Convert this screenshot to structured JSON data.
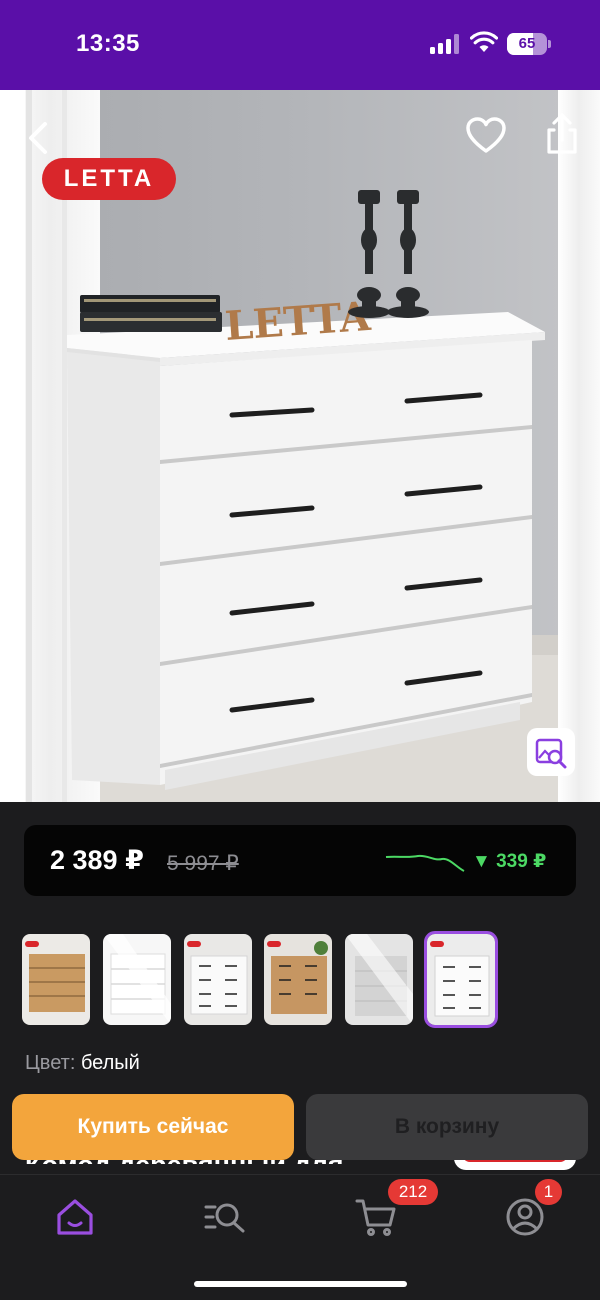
{
  "status_bar": {
    "time": "13:35",
    "battery_level": "65",
    "icons": [
      "signal-icon",
      "wifi-icon",
      "battery-icon"
    ]
  },
  "product_photo": {
    "brand_badge": "LETTA",
    "nav_icons": [
      "back-icon",
      "heart-icon",
      "share-icon",
      "visual-search-icon"
    ]
  },
  "price_card": {
    "current_price": "2 389 ₽",
    "old_price": "5 997 ₽",
    "price_drop": "▼ 339 ₽",
    "drop_color": "#4cd964"
  },
  "color_variants": {
    "thumbnails": [
      "oak",
      "white-glossy",
      "white",
      "oak",
      "light-grey",
      "white"
    ],
    "selected_index": 5,
    "label": "Цвет:",
    "value": "белый"
  },
  "actions": {
    "buy_now_label": "Купить сейчас",
    "add_to_cart_label": "В корзину",
    "buy_now_color": "#f3a53c"
  },
  "product_title_peek": "Комод деревянный для",
  "tab_bar": {
    "tabs": [
      "home-icon",
      "catalog-search-icon",
      "cart-icon",
      "profile-icon"
    ],
    "cart_badge": "212",
    "profile_badge": "1",
    "active_color": "#9a4ee0"
  }
}
